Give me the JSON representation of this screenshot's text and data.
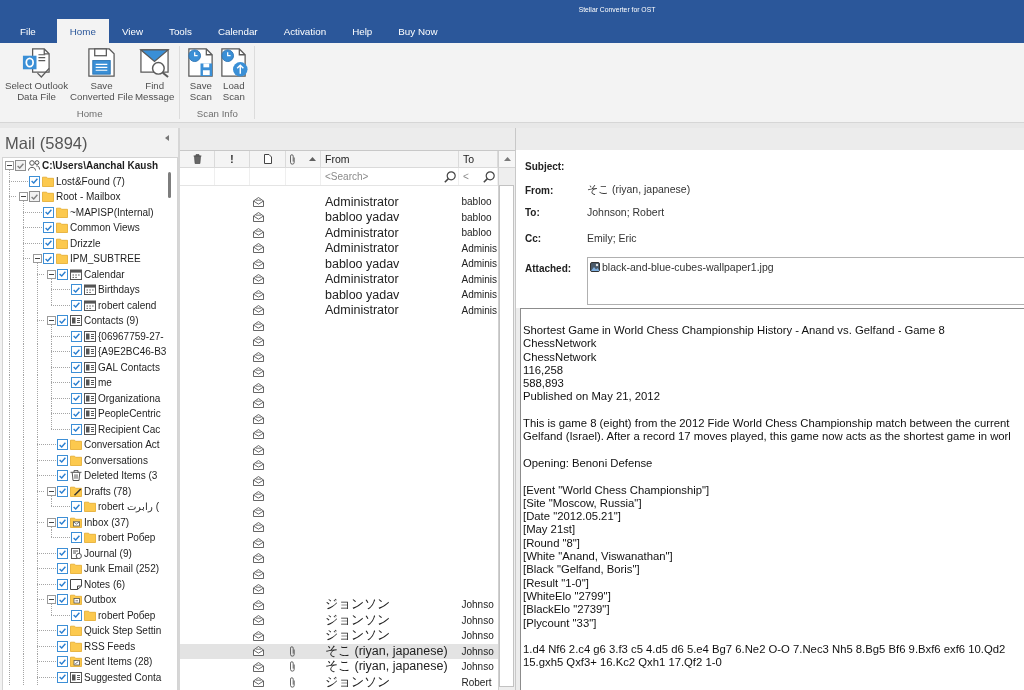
{
  "window": {
    "title": "Stellar Converter for OST"
  },
  "tabs": [
    {
      "label": "File",
      "selected": false
    },
    {
      "label": "Home",
      "selected": true
    },
    {
      "label": "View",
      "selected": false
    },
    {
      "label": "Tools",
      "selected": false
    },
    {
      "label": "Calendar",
      "selected": false
    },
    {
      "label": "Activation",
      "selected": false
    },
    {
      "label": "Help",
      "selected": false
    },
    {
      "label": "Buy Now",
      "selected": false
    }
  ],
  "ribbon": {
    "groups": [
      {
        "label": "Home",
        "buttons": [
          {
            "kind": "outlook-file",
            "label": "Select Outlook\nData File"
          },
          {
            "kind": "save-file",
            "label": "Save\nConverted File"
          },
          {
            "kind": "find-message",
            "label": "Find\nMessage"
          }
        ]
      },
      {
        "label": "Scan Info",
        "buttons": [
          {
            "kind": "save-scan",
            "label": "Save\nScan"
          },
          {
            "kind": "load-scan",
            "label": "Load\nScan"
          }
        ]
      }
    ]
  },
  "folder_pane": {
    "title": "Mail (5894)",
    "tree": [
      {
        "kind": "root",
        "label": "C:\\Users\\Aanchal Kaush",
        "checked": true,
        "disabled": true,
        "expanded": true,
        "children": [
          {
            "kind": "folder",
            "label": "Lost&Found (7)",
            "checked": true,
            "disabled": false
          },
          {
            "kind": "folder",
            "label": "Root - Mailbox",
            "checked": true,
            "disabled": true,
            "expanded": true,
            "children": [
              {
                "kind": "folder",
                "label": "~MAPISP(Internal)",
                "checked": true,
                "disabled": false
              },
              {
                "kind": "folder",
                "label": "Common Views",
                "checked": true,
                "disabled": false
              },
              {
                "kind": "folder",
                "label": "Drizzle",
                "checked": true,
                "disabled": false
              },
              {
                "kind": "folder",
                "label": "IPM_SUBTREE",
                "checked": true,
                "disabled": false,
                "expanded": true,
                "children": [
                  {
                    "kind": "calendar",
                    "label": "Calendar",
                    "checked": true,
                    "disabled": false,
                    "expanded": true,
                    "children": [
                      {
                        "kind": "calendar",
                        "label": "Birthdays",
                        "checked": true,
                        "disabled": false
                      },
                      {
                        "kind": "calendar",
                        "label": "robert calend",
                        "checked": true,
                        "disabled": false
                      }
                    ]
                  },
                  {
                    "kind": "contacts",
                    "label": "Contacts (9)",
                    "checked": true,
                    "disabled": false,
                    "expanded": true,
                    "children": [
                      {
                        "kind": "contacts",
                        "label": "{06967759-27-",
                        "checked": true,
                        "disabled": false
                      },
                      {
                        "kind": "contacts",
                        "label": "{A9E2BC46-B3",
                        "checked": true,
                        "disabled": false
                      },
                      {
                        "kind": "contacts",
                        "label": "GAL Contacts",
                        "checked": true,
                        "disabled": false
                      },
                      {
                        "kind": "contacts",
                        "label": "me",
                        "checked": true,
                        "disabled": false
                      },
                      {
                        "kind": "contacts",
                        "label": "Organizationa",
                        "checked": true,
                        "disabled": false
                      },
                      {
                        "kind": "contacts",
                        "label": "PeopleCentric",
                        "checked": true,
                        "disabled": false
                      },
                      {
                        "kind": "contacts",
                        "label": "Recipient Cac",
                        "checked": true,
                        "disabled": false
                      }
                    ]
                  },
                  {
                    "kind": "folder",
                    "label": "Conversation Act",
                    "checked": true,
                    "disabled": false
                  },
                  {
                    "kind": "folder",
                    "label": "Conversations",
                    "checked": true,
                    "disabled": false
                  },
                  {
                    "kind": "trash",
                    "label": "Deleted Items (3",
                    "checked": true,
                    "disabled": false
                  },
                  {
                    "kind": "drafts",
                    "label": "Drafts (78)",
                    "checked": true,
                    "disabled": false,
                    "expanded": true,
                    "children": [
                      {
                        "kind": "folder",
                        "label": "robert رابرت (",
                        "checked": true,
                        "disabled": false
                      }
                    ]
                  },
                  {
                    "kind": "inbox",
                    "label": "Inbox (37)",
                    "checked": true,
                    "disabled": false,
                    "expanded": true,
                    "children": [
                      {
                        "kind": "folder",
                        "label": "robert Робер",
                        "checked": true,
                        "disabled": false
                      }
                    ]
                  },
                  {
                    "kind": "journal",
                    "label": "Journal (9)",
                    "checked": true,
                    "disabled": false
                  },
                  {
                    "kind": "folder",
                    "label": "Junk Email (252)",
                    "checked": true,
                    "disabled": false
                  },
                  {
                    "kind": "notes",
                    "label": "Notes (6)",
                    "checked": true,
                    "disabled": false
                  },
                  {
                    "kind": "outbox",
                    "label": "Outbox",
                    "checked": true,
                    "disabled": false,
                    "expanded": true,
                    "children": [
                      {
                        "kind": "folder",
                        "label": "robert Робер",
                        "checked": true,
                        "disabled": false
                      }
                    ]
                  },
                  {
                    "kind": "folder",
                    "label": "Quick Step Settin",
                    "checked": true,
                    "disabled": false
                  },
                  {
                    "kind": "folder",
                    "label": "RSS Feeds",
                    "checked": true,
                    "disabled": false
                  },
                  {
                    "kind": "sent",
                    "label": "Sent Items (28)",
                    "checked": true,
                    "disabled": false
                  },
                  {
                    "kind": "contacts",
                    "label": "Suggested Conta",
                    "checked": true,
                    "disabled": false
                  }
                ]
              }
            ]
          }
        ]
      }
    ]
  },
  "message_list": {
    "columns": [
      {
        "kind": "deleted",
        "sorted": false
      },
      {
        "kind": "importance",
        "label": "!",
        "sorted": false
      },
      {
        "kind": "item-type",
        "sorted": false
      },
      {
        "kind": "attachment",
        "sorted": true
      },
      {
        "kind": "from",
        "label": "From",
        "sorted": false,
        "placeholder": "<Search>"
      },
      {
        "kind": "to",
        "label": "To",
        "sorted": false,
        "placeholder": "<"
      }
    ],
    "rows": [
      {
        "from": "Administrator",
        "to": "babloo",
        "attachment": false,
        "selected": false
      },
      {
        "from": "babloo yadav",
        "to": "babloo",
        "attachment": false,
        "selected": false
      },
      {
        "from": "Administrator",
        "to": "babloo",
        "attachment": false,
        "selected": false
      },
      {
        "from": "Administrator",
        "to": "Adminis",
        "attachment": false,
        "selected": false
      },
      {
        "from": "babloo yadav",
        "to": "Adminis",
        "attachment": false,
        "selected": false
      },
      {
        "from": "Administrator",
        "to": "Adminis",
        "attachment": false,
        "selected": false
      },
      {
        "from": "babloo yadav",
        "to": "Adminis",
        "attachment": false,
        "selected": false
      },
      {
        "from": "Administrator",
        "to": "Adminis",
        "attachment": false,
        "selected": false
      },
      {
        "attachment": false,
        "selected": false
      },
      {
        "attachment": false,
        "selected": false
      },
      {
        "attachment": false,
        "selected": false
      },
      {
        "attachment": false,
        "selected": false
      },
      {
        "attachment": false,
        "selected": false
      },
      {
        "attachment": false,
        "selected": false
      },
      {
        "attachment": false,
        "selected": false
      },
      {
        "attachment": false,
        "selected": false
      },
      {
        "attachment": false,
        "selected": false
      },
      {
        "attachment": false,
        "selected": false
      },
      {
        "attachment": false,
        "selected": false
      },
      {
        "attachment": false,
        "selected": false
      },
      {
        "attachment": false,
        "selected": false
      },
      {
        "attachment": false,
        "selected": false
      },
      {
        "attachment": false,
        "selected": false
      },
      {
        "attachment": false,
        "selected": false
      },
      {
        "attachment": false,
        "selected": false
      },
      {
        "attachment": false,
        "selected": false
      },
      {
        "from": "ジョンソン",
        "to": "Johnso",
        "attachment": false,
        "selected": false
      },
      {
        "from": "ジョンソン",
        "to": "Johnso",
        "attachment": false,
        "selected": false
      },
      {
        "from": "ジョンソン",
        "to": "Johnso",
        "attachment": false,
        "selected": false
      },
      {
        "from": "そこ (riyan, japanese)",
        "to": "Johnso",
        "attachment": true,
        "selected": true
      },
      {
        "from": "そこ (riyan, japanese)",
        "to": "Johnso",
        "attachment": true,
        "selected": false
      },
      {
        "from": "ジョンソン",
        "to": "Robert",
        "attachment": true,
        "selected": false
      }
    ]
  },
  "reading_pane": {
    "fields": [
      {
        "label": "Subject:"
      },
      {
        "label": "From:",
        "value": "そこ (riyan, japanese)"
      },
      {
        "label": "To:",
        "value": "Johnson; Robert"
      },
      {
        "label": "Cc:",
        "value": "Emily; Eric"
      }
    ],
    "attached": {
      "label": "Attached:",
      "files": [
        {
          "name": "black-and-blue-cubes-wallpaper1.jpg"
        }
      ]
    },
    "body": [
      "Shortest Game in World Chess Championship History - Anand vs. Gelfand - Game 8\nChessNetwork\nChessNetwork\n116,258\n588,893\nPublished on May 21, 2012",
      "This is game 8 (eight) from the 2012 Fide World Chess Championship match between the current\nGelfand (Israel). After a record 17 moves played, this game now acts as the shortest game in worl",
      "Opening: Benoni Defense",
      "[Event \"World Chess Championship\"]\n[Site \"Moscow, Russia\"]\n[Date \"2012.05.21\"]\n[May 21st]\n[Round \"8\"]\n[White \"Anand, Viswanathan\"]\n[Black \"Gelfand, Boris\"]\n[Result \"1-0\"]\n[WhiteElo \"2799\"]\n[BlackElo \"2739\"]\n[Plycount \"33\"]",
      "1.d4 Nf6 2.c4 g6 3.f3 c5 4.d5 d6 5.e4 Bg7 6.Ne2 O-O 7.Nec3 Nh5 8.Bg5 Bf6 9.Bxf6 exf6 10.Qd2\n15.gxh5 Qxf3+ 16.Kc2 Qxh1 17.Qf2 1-0"
    ]
  }
}
